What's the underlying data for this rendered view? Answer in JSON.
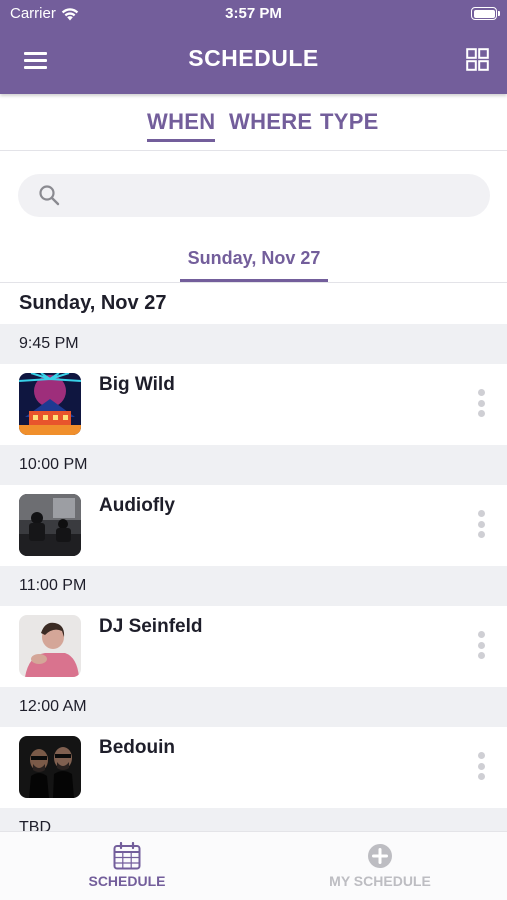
{
  "status_bar": {
    "carrier": "Carrier",
    "time": "3:57 PM"
  },
  "nav": {
    "title": "SCHEDULE"
  },
  "filter_tabs": [
    {
      "label": "WHEN",
      "active": true
    },
    {
      "label": "WHERE",
      "active": false
    },
    {
      "label": "TYPE",
      "active": false
    }
  ],
  "search": {
    "placeholder": ""
  },
  "date_tab": {
    "label": "Sunday, Nov 27"
  },
  "day_heading": "Sunday, Nov 27",
  "slots": [
    {
      "time": "9:45 PM",
      "artist": "Big Wild",
      "thumb_icon": "big-wild-artwork"
    },
    {
      "time": "10:00 PM",
      "artist": "Audiofly",
      "thumb_icon": "audiofly-photo"
    },
    {
      "time": "11:00 PM",
      "artist": "DJ Seinfeld",
      "thumb_icon": "dj-seinfeld-photo"
    },
    {
      "time": "12:00 AM",
      "artist": "Bedouin",
      "thumb_icon": "bedouin-photo"
    },
    {
      "time": "TBD"
    }
  ],
  "tab_bar": {
    "schedule_label": "SCHEDULE",
    "my_schedule_label": "MY SCHEDULE"
  },
  "colors": {
    "brand": "#735e9b",
    "time_header_bg": "#eff0f3",
    "inactive_tab": "#bdbdc2"
  }
}
